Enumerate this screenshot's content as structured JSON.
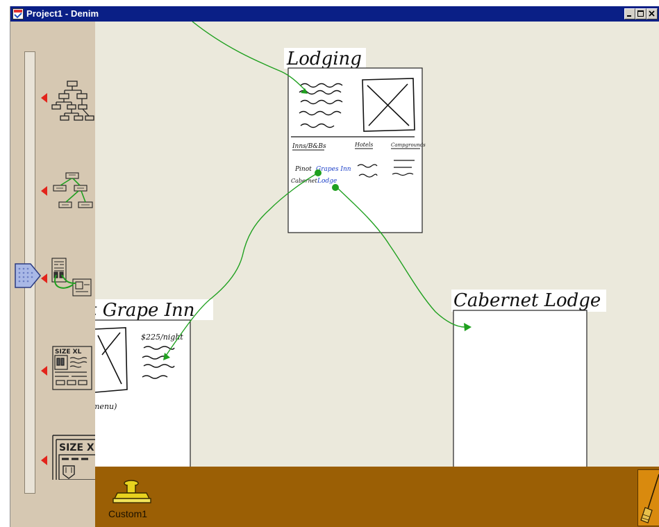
{
  "window": {
    "title": "Project1 - Denim",
    "controls": [
      "minimize",
      "maximize",
      "close"
    ]
  },
  "zoom_slider": {
    "levels": [
      {
        "name": "sitemap",
        "icon": "sitemap-view-icon"
      },
      {
        "name": "storyboard",
        "icon": "storyboard-view-icon"
      },
      {
        "name": "page-links",
        "icon": "page-link-view-icon"
      },
      {
        "name": "page",
        "icon": "page-view-icon"
      },
      {
        "name": "detail",
        "icon": "detail-view-icon"
      }
    ],
    "current_level": 3
  },
  "pages": {
    "lodging": {
      "title": "Lodging",
      "labels": {
        "inns": "Inns/B&Bs",
        "hotels": "Hotels",
        "campgrounds": "Campgrounds",
        "item1_a": "Pinot",
        "item1_b": "Grapes Inn",
        "item2_a": "Cabernet",
        "item2_b": "Lodge"
      }
    },
    "grape_inn": {
      "title": "t Grape Inn",
      "price": "$225/night",
      "footer": "menu)"
    },
    "cabernet_lodge": {
      "title": "Cabernet Lodge"
    }
  },
  "toolbar": {
    "stamp_label": "Custom1",
    "stamp_icon": "rubber-stamp-icon",
    "eraser_icon": "broom-icon"
  },
  "colors": {
    "titlebar": "#0a1f86",
    "sidebar": "#d6c8b2",
    "canvas": "#ebe9dc",
    "toolbar": "#9b5f05",
    "link_arrow": "#1fa01f",
    "level_marker": "#e3241b"
  }
}
